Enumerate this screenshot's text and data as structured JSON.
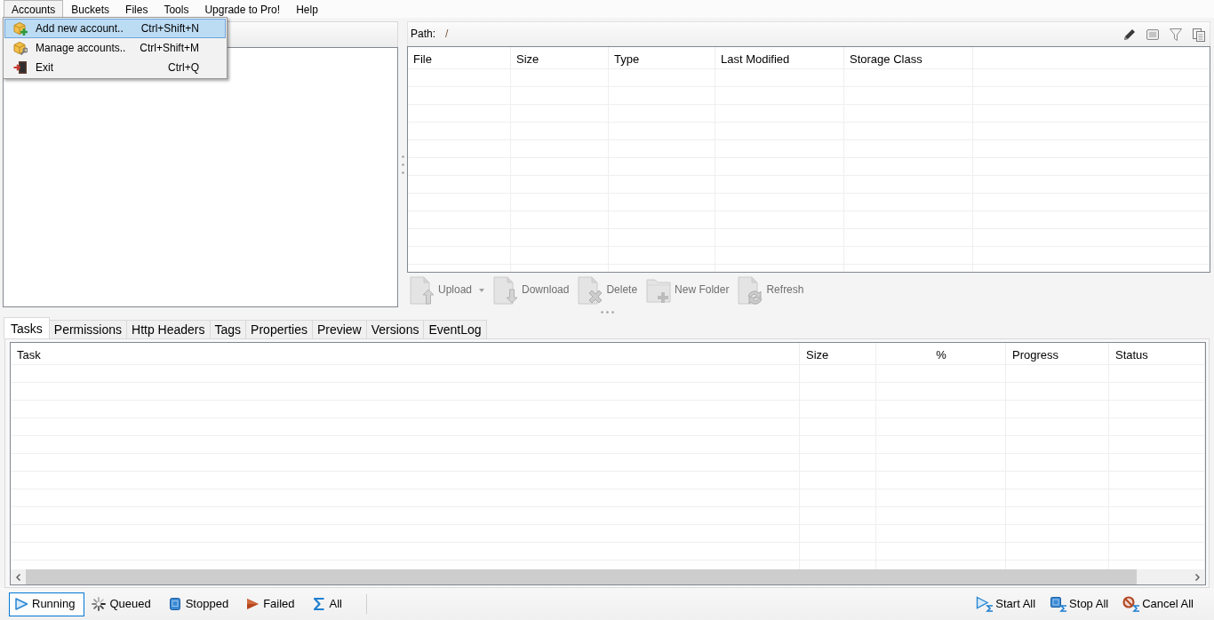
{
  "menu_bar": [
    {
      "label": "Accounts",
      "selected": true
    },
    {
      "label": "Buckets",
      "selected": false
    },
    {
      "label": "Files",
      "selected": false
    },
    {
      "label": "Tools",
      "selected": false
    },
    {
      "label": "Upgrade to Pro!",
      "selected": false
    },
    {
      "label": "Help",
      "selected": false
    }
  ],
  "open_menu": {
    "items": [
      {
        "label": "Add new account..",
        "shortcut": "Ctrl+Shift+N",
        "selected": true
      },
      {
        "label": "Manage accounts..",
        "shortcut": "Ctrl+Shift+M",
        "selected": false
      },
      {
        "label": "Exit",
        "shortcut": "Ctrl+Q",
        "selected": false
      }
    ]
  },
  "file_panel": {
    "path_label": "Path:",
    "path": "/",
    "columns": [
      "File",
      "Size",
      "Type",
      "Last Modified",
      "Storage Class"
    ],
    "toolbar": [
      {
        "label": "Upload",
        "dropdown": true,
        "disabled": true
      },
      {
        "label": "Download",
        "dropdown": false,
        "disabled": true
      },
      {
        "label": "Delete",
        "dropdown": false,
        "disabled": true
      },
      {
        "label": "New Folder",
        "dropdown": false,
        "disabled": true
      },
      {
        "label": "Refresh",
        "dropdown": false,
        "disabled": true
      }
    ]
  },
  "tabs": [
    {
      "label": "Tasks",
      "selected": true
    },
    {
      "label": "Permissions",
      "selected": false
    },
    {
      "label": "Http Headers",
      "selected": false
    },
    {
      "label": "Tags",
      "selected": false
    },
    {
      "label": "Properties",
      "selected": false
    },
    {
      "label": "Preview",
      "selected": false
    },
    {
      "label": "Versions",
      "selected": false
    },
    {
      "label": "EventLog",
      "selected": false
    }
  ],
  "tasks_table": {
    "columns": [
      "Task",
      "Size",
      "%",
      "Progress",
      "Status"
    ]
  },
  "task_filters": [
    {
      "label": "Running",
      "selected": true
    },
    {
      "label": "Queued",
      "selected": false
    },
    {
      "label": "Stopped",
      "selected": false
    },
    {
      "label": "Failed",
      "selected": false
    },
    {
      "label": "All",
      "selected": false
    }
  ],
  "task_actions": [
    {
      "label": "Start All"
    },
    {
      "label": "Stop All"
    },
    {
      "label": "Cancel All"
    }
  ]
}
